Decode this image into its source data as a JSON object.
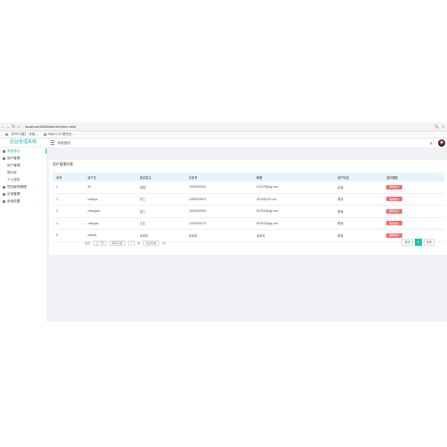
{
  "browser": {
    "url": "localhost:8080/admin/index.html",
    "bookmarks": [
      "【DIR小组】 分组…",
      "SayCo 24 首页大…"
    ]
  },
  "sidebar": {
    "brand": "后台管理系统",
    "items": [
      {
        "label": "系统首页",
        "type": "item",
        "active": true
      },
      {
        "label": "用户管理",
        "type": "group"
      },
      {
        "label": "用户管理",
        "type": "sub"
      },
      {
        "label": "图片库",
        "type": "sub"
      },
      {
        "label": "个人资料",
        "type": "sub"
      },
      {
        "label": "项目案例管理",
        "type": "group"
      },
      {
        "label": "反馈管理",
        "type": "item"
      },
      {
        "label": "系统设置",
        "type": "group"
      }
    ]
  },
  "header": {
    "breadcrumb": "系统首页"
  },
  "main": {
    "title": "用户管理列表",
    "columns": [
      "序号",
      "用户名",
      "真实姓名",
      "手机号",
      "邮箱",
      "用户状态",
      "操作删除"
    ],
    "rows": [
      [
        "1",
        "lhl",
        "刘阳",
        "15180000000",
        "123123@qq.com",
        "启用",
        "删除用户"
      ],
      [
        "2",
        "hahaya",
        "刘三",
        "13390929912",
        "3313@231.com",
        "禁用",
        "删除用户"
      ],
      [
        "3",
        "zhangsan",
        "张三",
        "15180000000",
        "567542@qq.com",
        "禁用",
        "删除用户"
      ],
      [
        "4",
        "zhangsa",
        "王五",
        "13335281273",
        "567542@qq.com",
        "禁用",
        "删除用户"
      ],
      [
        "5",
        "zhaoliu",
        "未填写",
        "未填写",
        "未填写",
        "禁用",
        "删除用户"
      ]
    ],
    "pager_left": [
      "首页",
      "上一页",
      "每页条数",
      "1",
      "第",
      "共总条数",
      "1页"
    ],
    "pager_right": {
      "prev": "首页",
      "current": "1",
      "next": "末页"
    }
  }
}
